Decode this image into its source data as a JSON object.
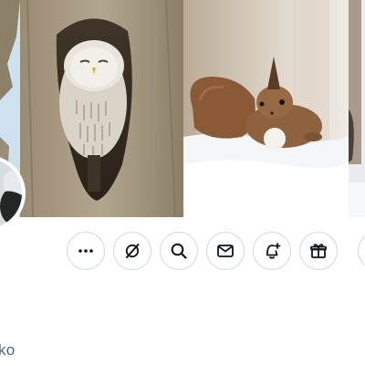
{
  "header": {
    "photos": [
      {
        "subject": "tree-branch"
      },
      {
        "subject": "ural-owl-in-tree-hollow"
      },
      {
        "subject": "red-squirrel-in-snow"
      },
      {
        "subject": "tree-trunk-edge"
      }
    ]
  },
  "profile": {
    "name_fragment": "ko"
  },
  "actions": [
    {
      "icon": "more-icon"
    },
    {
      "icon": "grok-icon"
    },
    {
      "icon": "search-icon"
    },
    {
      "icon": "message-icon"
    },
    {
      "icon": "notification-add-icon"
    },
    {
      "icon": "gift-icon"
    }
  ],
  "colors": {
    "icon": "#0f1419",
    "border": "#cfd9de",
    "secondary_text": "#536471"
  }
}
